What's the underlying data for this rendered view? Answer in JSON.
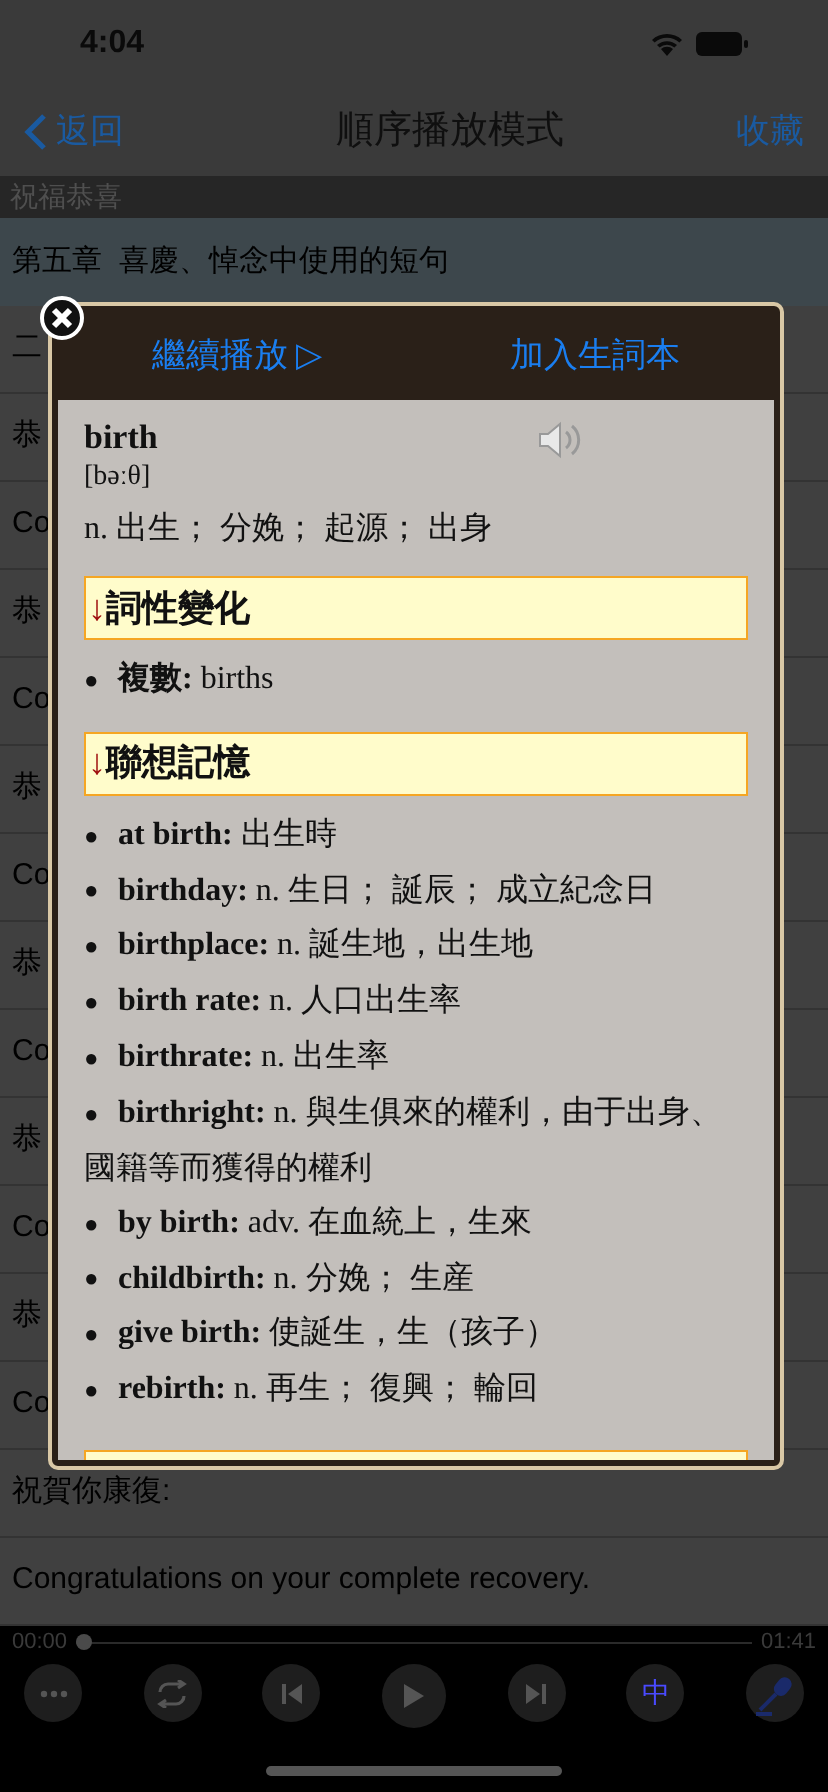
{
  "status_bar": {
    "time": "4:04"
  },
  "nav": {
    "back": "返回",
    "title": "順序播放模式",
    "action": "收藏"
  },
  "section_header": "祝福恭喜",
  "chapter": "第五章  喜慶、悼念中使用的短句",
  "rows": [
    "二",
    "恭",
    "Co",
    "恭",
    "Co",
    "恭",
    "Co",
    "恭",
    "Co",
    "恭",
    "Co",
    "恭",
    "Co",
    "祝賀你康復:",
    "Congratulations on your complete recovery."
  ],
  "popup": {
    "buttons": [
      {
        "label": "繼續播放",
        "icon": "▷"
      },
      {
        "label": "加入生詞本"
      }
    ],
    "word": "birth",
    "phonetic": "[bəːθ]",
    "definition": "n. 出生； 分娩； 起源； 出身",
    "sections": [
      {
        "arrow": "↓",
        "title": "詞性變化",
        "items": [
          {
            "bullet": "●",
            "term": "複數:",
            "text": "births"
          }
        ]
      },
      {
        "arrow": "↓",
        "title": "聯想記憶",
        "items": [
          {
            "bullet": "●",
            "term": "at birth:",
            "text": "出生時"
          },
          {
            "bullet": "●",
            "term": "birthday:",
            "text": "n. 生日； 誕辰； 成立紀念日"
          },
          {
            "bullet": "●",
            "term": "birthplace:",
            "text": "n. 誕生地，出生地"
          },
          {
            "bullet": "●",
            "term": "birth rate:",
            "text": "n. 人口出生率"
          },
          {
            "bullet": "●",
            "term": "birthrate:",
            "text": "n. 出生率"
          },
          {
            "bullet": "●",
            "term": "birthright:",
            "text": "n. 與生俱來的權利，由于出身、國籍等而獲得的權利"
          },
          {
            "bullet": "●",
            "term": "by birth:",
            "text": "adv. 在血統上，生來"
          },
          {
            "bullet": "●",
            "term": "childbirth:",
            "text": "n. 分娩； 生産"
          },
          {
            "bullet": "●",
            "term": "give birth:",
            "text": "使誕生，生（孩子）"
          },
          {
            "bullet": "●",
            "term": "rebirth:",
            "text": "n. 再生； 復興； 輪回"
          }
        ]
      }
    ]
  },
  "player": {
    "elapsed": "00:00",
    "total": "01:41",
    "level": 0,
    "controls": [
      {
        "kind": "more"
      },
      {
        "kind": "repeat"
      },
      {
        "kind": "prev"
      },
      {
        "kind": "play"
      },
      {
        "kind": "next"
      },
      {
        "kind": "text",
        "label": "中"
      },
      {
        "kind": "mic"
      }
    ]
  }
}
